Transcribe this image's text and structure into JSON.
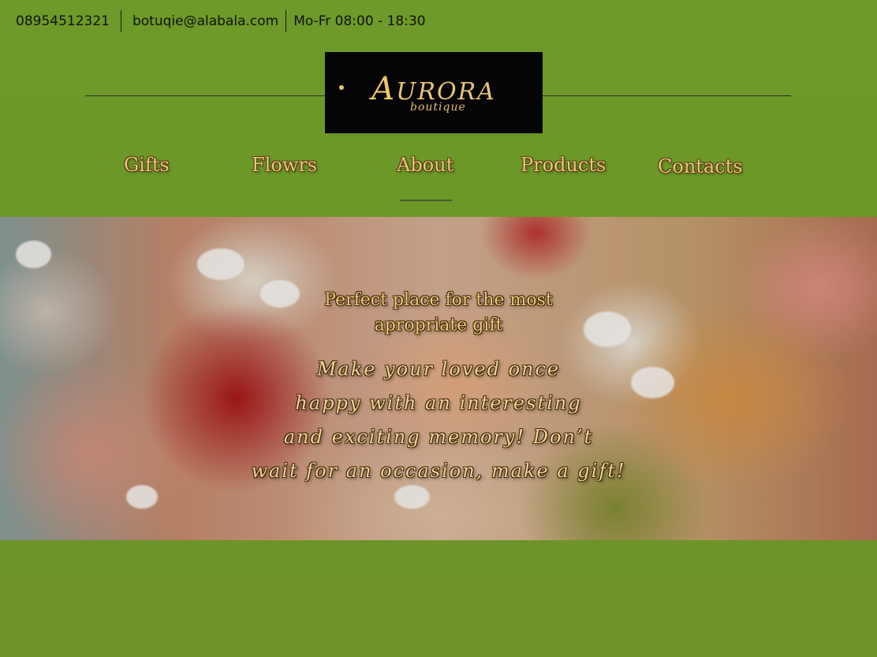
{
  "contact": {
    "phone": "08954512321",
    "email": "botuqie@alabala.com",
    "hours": "Mo-Fr 08:00 - 18:30"
  },
  "logo": {
    "brand": "AURORA",
    "subtitle": "boutique",
    "bg_color": "#050505",
    "text_color": "#e8c577"
  },
  "nav": {
    "items": [
      {
        "label": "Gifts"
      },
      {
        "label": "Flowrs"
      },
      {
        "label": "About"
      },
      {
        "label": "Products"
      },
      {
        "label": "Contacts"
      }
    ],
    "active": "About"
  },
  "hero": {
    "tagline": [
      "Perfect place for the most",
      "apropriate gift"
    ],
    "body": [
      "Make your loved once",
      "happy with an interesting",
      "and exciting memory! Don’t",
      "wait for an occasion, make a gift!"
    ]
  },
  "colors": {
    "page_bg": "#6d9a28",
    "nav_text": "#e7c880",
    "hero_text": "#f3d49a"
  }
}
